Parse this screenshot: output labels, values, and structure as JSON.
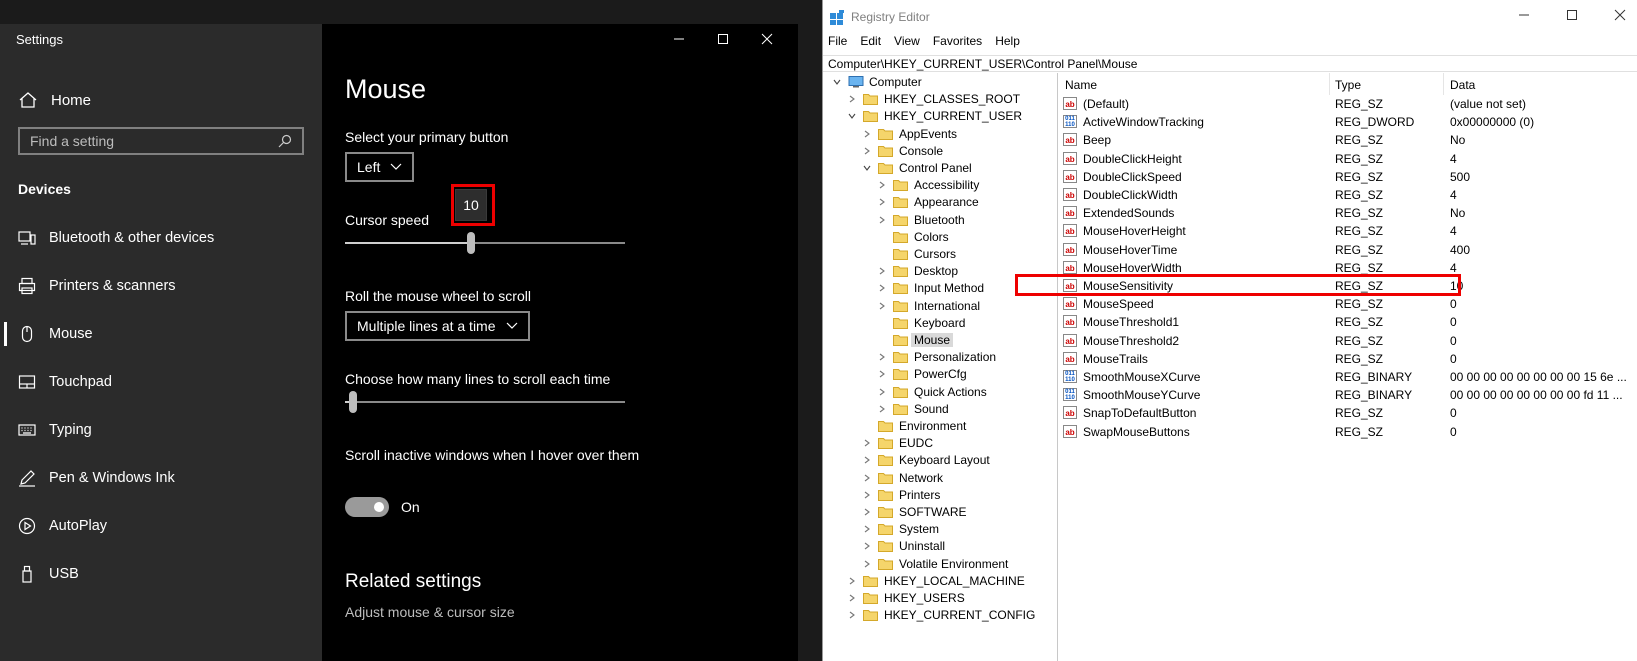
{
  "settings": {
    "window_title": "Settings",
    "home_label": "Home",
    "search_placeholder": "Find a setting",
    "section_title": "Devices",
    "nav": [
      {
        "label": "Bluetooth & other devices",
        "icon": "bluetooth-devices-icon"
      },
      {
        "label": "Printers & scanners",
        "icon": "printer-icon"
      },
      {
        "label": "Mouse",
        "icon": "mouse-icon",
        "active": true
      },
      {
        "label": "Touchpad",
        "icon": "touchpad-icon"
      },
      {
        "label": "Typing",
        "icon": "keyboard-icon"
      },
      {
        "label": "Pen & Windows Ink",
        "icon": "pen-icon"
      },
      {
        "label": "AutoPlay",
        "icon": "autoplay-icon"
      },
      {
        "label": "USB",
        "icon": "usb-icon"
      }
    ],
    "page_title": "Mouse",
    "primary_button_label": "Select your primary button",
    "primary_button_value": "Left",
    "cursor_speed_label": "Cursor speed",
    "cursor_speed_value": "10",
    "cursor_speed_fraction": 0.45,
    "scroll_label": "Roll the mouse wheel to scroll",
    "scroll_value": "Multiple lines at a time",
    "lines_label": "Choose how many lines to scroll each time",
    "lines_fraction": 0.03,
    "inactive_label": "Scroll inactive windows when I hover over them",
    "toggle_state": "On",
    "related_title": "Related settings",
    "related_link": "Adjust mouse & cursor size"
  },
  "regedit": {
    "title": "Registry Editor",
    "menu": [
      "File",
      "Edit",
      "View",
      "Favorites",
      "Help"
    ],
    "address": "Computer\\HKEY_CURRENT_USER\\Control Panel\\Mouse",
    "tree": [
      {
        "label": "Computer",
        "level": 0,
        "exp": "open",
        "icon": "computer"
      },
      {
        "label": "HKEY_CLASSES_ROOT",
        "level": 1,
        "exp": "closed"
      },
      {
        "label": "HKEY_CURRENT_USER",
        "level": 1,
        "exp": "open"
      },
      {
        "label": "AppEvents",
        "level": 2,
        "exp": "closed"
      },
      {
        "label": "Console",
        "level": 2,
        "exp": "closed"
      },
      {
        "label": "Control Panel",
        "level": 2,
        "exp": "open"
      },
      {
        "label": "Accessibility",
        "level": 3,
        "exp": "closed"
      },
      {
        "label": "Appearance",
        "level": 3,
        "exp": "closed"
      },
      {
        "label": "Bluetooth",
        "level": 3,
        "exp": "closed"
      },
      {
        "label": "Colors",
        "level": 3,
        "exp": "none"
      },
      {
        "label": "Cursors",
        "level": 3,
        "exp": "none"
      },
      {
        "label": "Desktop",
        "level": 3,
        "exp": "closed"
      },
      {
        "label": "Input Method",
        "level": 3,
        "exp": "closed"
      },
      {
        "label": "International",
        "level": 3,
        "exp": "closed"
      },
      {
        "label": "Keyboard",
        "level": 3,
        "exp": "none"
      },
      {
        "label": "Mouse",
        "level": 3,
        "exp": "none",
        "selected": true
      },
      {
        "label": "Personalization",
        "level": 3,
        "exp": "closed"
      },
      {
        "label": "PowerCfg",
        "level": 3,
        "exp": "closed"
      },
      {
        "label": "Quick Actions",
        "level": 3,
        "exp": "closed"
      },
      {
        "label": "Sound",
        "level": 3,
        "exp": "closed"
      },
      {
        "label": "Environment",
        "level": 2,
        "exp": "none"
      },
      {
        "label": "EUDC",
        "level": 2,
        "exp": "closed"
      },
      {
        "label": "Keyboard Layout",
        "level": 2,
        "exp": "closed"
      },
      {
        "label": "Network",
        "level": 2,
        "exp": "closed"
      },
      {
        "label": "Printers",
        "level": 2,
        "exp": "closed"
      },
      {
        "label": "SOFTWARE",
        "level": 2,
        "exp": "closed"
      },
      {
        "label": "System",
        "level": 2,
        "exp": "closed"
      },
      {
        "label": "Uninstall",
        "level": 2,
        "exp": "closed"
      },
      {
        "label": "Volatile Environment",
        "level": 2,
        "exp": "closed"
      },
      {
        "label": "HKEY_LOCAL_MACHINE",
        "level": 1,
        "exp": "closed"
      },
      {
        "label": "HKEY_USERS",
        "level": 1,
        "exp": "closed"
      },
      {
        "label": "HKEY_CURRENT_CONFIG",
        "level": 1,
        "exp": "closed"
      }
    ],
    "columns": [
      "Name",
      "Type",
      "Data"
    ],
    "values": [
      {
        "name": "(Default)",
        "type": "REG_SZ",
        "data": "(value not set)",
        "kind": "sz"
      },
      {
        "name": "ActiveWindowTracking",
        "type": "REG_DWORD",
        "data": "0x00000000 (0)",
        "kind": "bin"
      },
      {
        "name": "Beep",
        "type": "REG_SZ",
        "data": "No",
        "kind": "sz"
      },
      {
        "name": "DoubleClickHeight",
        "type": "REG_SZ",
        "data": "4",
        "kind": "sz"
      },
      {
        "name": "DoubleClickSpeed",
        "type": "REG_SZ",
        "data": "500",
        "kind": "sz"
      },
      {
        "name": "DoubleClickWidth",
        "type": "REG_SZ",
        "data": "4",
        "kind": "sz"
      },
      {
        "name": "ExtendedSounds",
        "type": "REG_SZ",
        "data": "No",
        "kind": "sz"
      },
      {
        "name": "MouseHoverHeight",
        "type": "REG_SZ",
        "data": "4",
        "kind": "sz"
      },
      {
        "name": "MouseHoverTime",
        "type": "REG_SZ",
        "data": "400",
        "kind": "sz"
      },
      {
        "name": "MouseHoverWidth",
        "type": "REG_SZ",
        "data": "4",
        "kind": "sz"
      },
      {
        "name": "MouseSensitivity",
        "type": "REG_SZ",
        "data": "10",
        "kind": "sz",
        "highlight": true
      },
      {
        "name": "MouseSpeed",
        "type": "REG_SZ",
        "data": "0",
        "kind": "sz"
      },
      {
        "name": "MouseThreshold1",
        "type": "REG_SZ",
        "data": "0",
        "kind": "sz"
      },
      {
        "name": "MouseThreshold2",
        "type": "REG_SZ",
        "data": "0",
        "kind": "sz"
      },
      {
        "name": "MouseTrails",
        "type": "REG_SZ",
        "data": "0",
        "kind": "sz"
      },
      {
        "name": "SmoothMouseXCurve",
        "type": "REG_BINARY",
        "data": "00 00 00 00 00 00 00 00 15 6e ...",
        "kind": "bin"
      },
      {
        "name": "SmoothMouseYCurve",
        "type": "REG_BINARY",
        "data": "00 00 00 00 00 00 00 00 fd 11 ...",
        "kind": "bin"
      },
      {
        "name": "SnapToDefaultButton",
        "type": "REG_SZ",
        "data": "0",
        "kind": "sz"
      },
      {
        "name": "SwapMouseButtons",
        "type": "REG_SZ",
        "data": "0",
        "kind": "sz"
      }
    ],
    "highlight_color": "#e00000"
  }
}
